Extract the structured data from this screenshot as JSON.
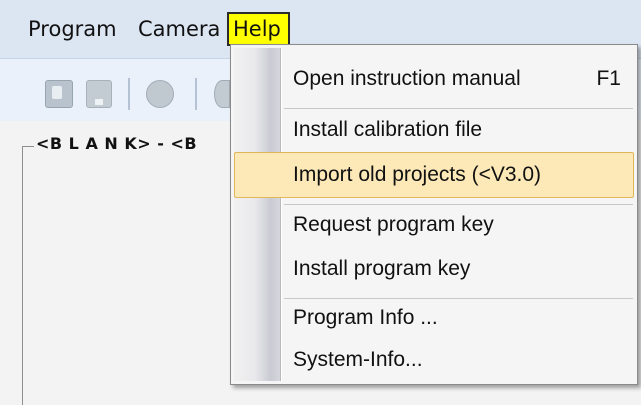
{
  "menubar": {
    "items": [
      {
        "label": "Program"
      },
      {
        "label": "Camera"
      },
      {
        "label": "Help"
      }
    ]
  },
  "toolbar": {
    "icons": [
      "file-icon",
      "save-icon",
      "camera-icon",
      "partial-icon"
    ]
  },
  "canvas": {
    "group_title": "<B L A N K> - <B"
  },
  "help_menu": {
    "items": [
      {
        "label": "Open instruction manual",
        "shortcut": "F1"
      },
      {
        "label": "Install calibration file"
      },
      {
        "label": "Import old projects (<V3.0)"
      },
      {
        "label": "Request program key"
      },
      {
        "label": "Install program key"
      },
      {
        "label": "Program Info ..."
      },
      {
        "label": "System-Info..."
      }
    ],
    "highlighted_index": 2,
    "highlight_color": "#fde9b8"
  }
}
